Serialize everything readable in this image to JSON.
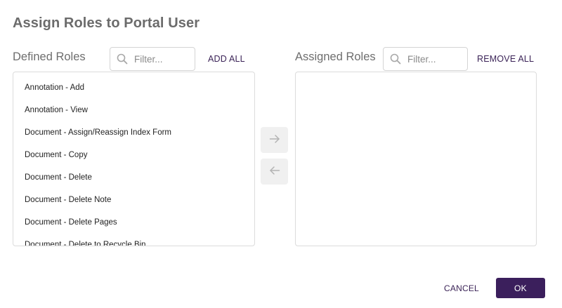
{
  "dialog": {
    "title": "Assign Roles to Portal User"
  },
  "defined": {
    "label": "Defined Roles",
    "filter_placeholder": "Filter...",
    "add_all_label": "ADD ALL",
    "items": [
      "Annotation - Add",
      "Annotation - View",
      "Document - Assign/Reassign Index Form",
      "Document - Copy",
      "Document - Delete",
      "Document - Delete Note",
      "Document - Delete Pages",
      "Document - Delete to Recycle Bin"
    ]
  },
  "assigned": {
    "label": "Assigned Roles",
    "filter_placeholder": "Filter...",
    "remove_all_label": "REMOVE ALL",
    "items": []
  },
  "transfer": {
    "add_icon": "arrow-right-icon",
    "remove_icon": "arrow-left-icon"
  },
  "footer": {
    "cancel_label": "CANCEL",
    "ok_label": "OK"
  },
  "colors": {
    "primary": "#3b1f5c",
    "muted_text": "#6e6e6e",
    "border": "#dcdcdc"
  }
}
